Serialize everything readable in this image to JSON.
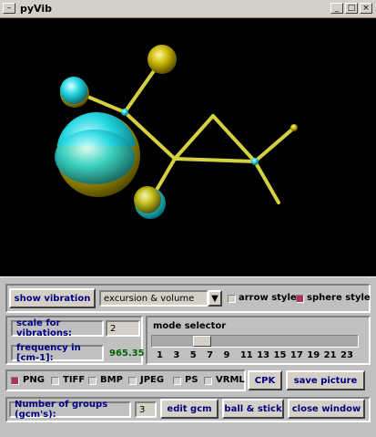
{
  "window": {
    "title": "pyVib",
    "menu_glyph": "–",
    "min_glyph": "_",
    "max_glyph": "□",
    "close_glyph": "×"
  },
  "colors": {
    "bond": "#d4d040",
    "atom_gold": "#c8b400",
    "atom_cyan": "#22d6e0",
    "label_blue": "#000080",
    "freq_green": "#006400",
    "check_on": "#b03060"
  },
  "controls": {
    "show_vibration": "show vibration",
    "style_select": "excursion & volume",
    "dropdown_icon": "▼",
    "arrow_style": "arrow style",
    "sphere_style": "sphere style",
    "arrow_style_checked": false,
    "sphere_style_checked": true
  },
  "scale": {
    "label": "scale for vibrations:",
    "value": "2"
  },
  "frequency": {
    "label": "frequency in [cm-1]:",
    "value": "965.35"
  },
  "mode_selector": {
    "label": "mode selector",
    "ticks": [
      "1",
      "3",
      "5",
      "7",
      "9",
      "11",
      "13",
      "15",
      "17",
      "19",
      "21",
      "23"
    ],
    "selected_fraction": 0.22
  },
  "formats": [
    {
      "label": "PNG",
      "checked": true
    },
    {
      "label": "TIFF",
      "checked": false
    },
    {
      "label": "BMP",
      "checked": false
    },
    {
      "label": "JPEG",
      "checked": false
    },
    {
      "label": "PS",
      "checked": false
    },
    {
      "label": "VRML",
      "checked": false
    }
  ],
  "buttons": {
    "cpk": "CPK",
    "save_picture": "save picture",
    "edit_gcm": "edit gcm",
    "ball_stick": "ball & stick",
    "close_window": "close window"
  },
  "groups": {
    "label": "Number of groups (gcm's):",
    "value": "3"
  }
}
